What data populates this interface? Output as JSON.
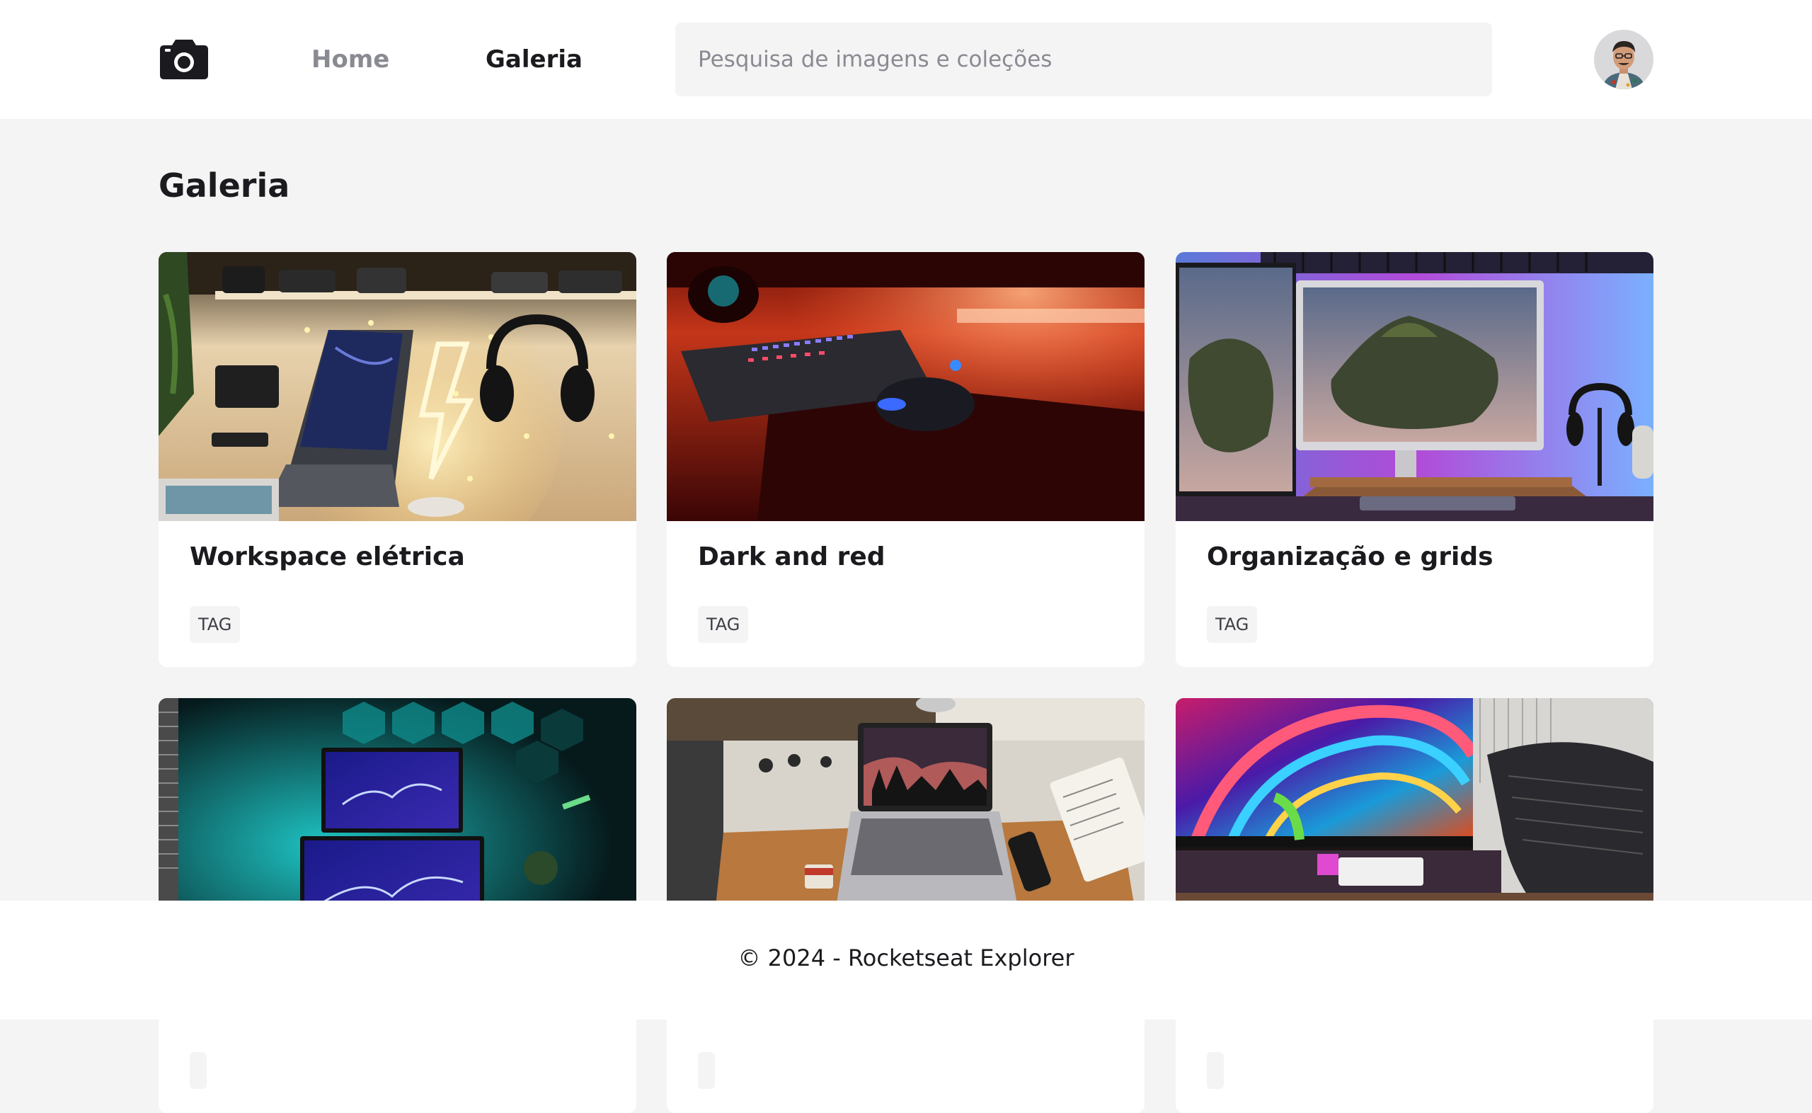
{
  "header": {
    "logo_icon": "camera-icon",
    "nav": {
      "home_label": "Home",
      "gallery_label": "Galeria"
    },
    "search": {
      "placeholder": "Pesquisa de imagens e coleções",
      "value": ""
    },
    "avatar_icon": "user-avatar"
  },
  "main": {
    "title": "Galeria",
    "cards": [
      {
        "title": "Workspace elétrica",
        "tag": "TAG",
        "image": "desk with laptop, headphones and neon lightning lamp"
      },
      {
        "title": "Dark and red",
        "tag": "TAG",
        "image": "keyboard and mouse under red light"
      },
      {
        "title": "Organização e grids",
        "tag": "TAG",
        "image": "monitors with island wallpaper and headphone stand"
      },
      {
        "title": "",
        "tag": "",
        "image": "dual monitors with teal hexagon wall"
      },
      {
        "title": "",
        "tag": "",
        "image": "laptop on desk mat with notebook and phone"
      },
      {
        "title": "",
        "tag": "",
        "image": "ultrawide monitor with colorful wallpaper and mesh chair"
      }
    ]
  },
  "footer": {
    "copyright": "© 2024 - Rocketseat Explorer"
  },
  "colors": {
    "background": "#f4f4f4",
    "surface": "#ffffff",
    "text_primary": "#1b1b1f",
    "text_muted": "#8a8a93"
  }
}
